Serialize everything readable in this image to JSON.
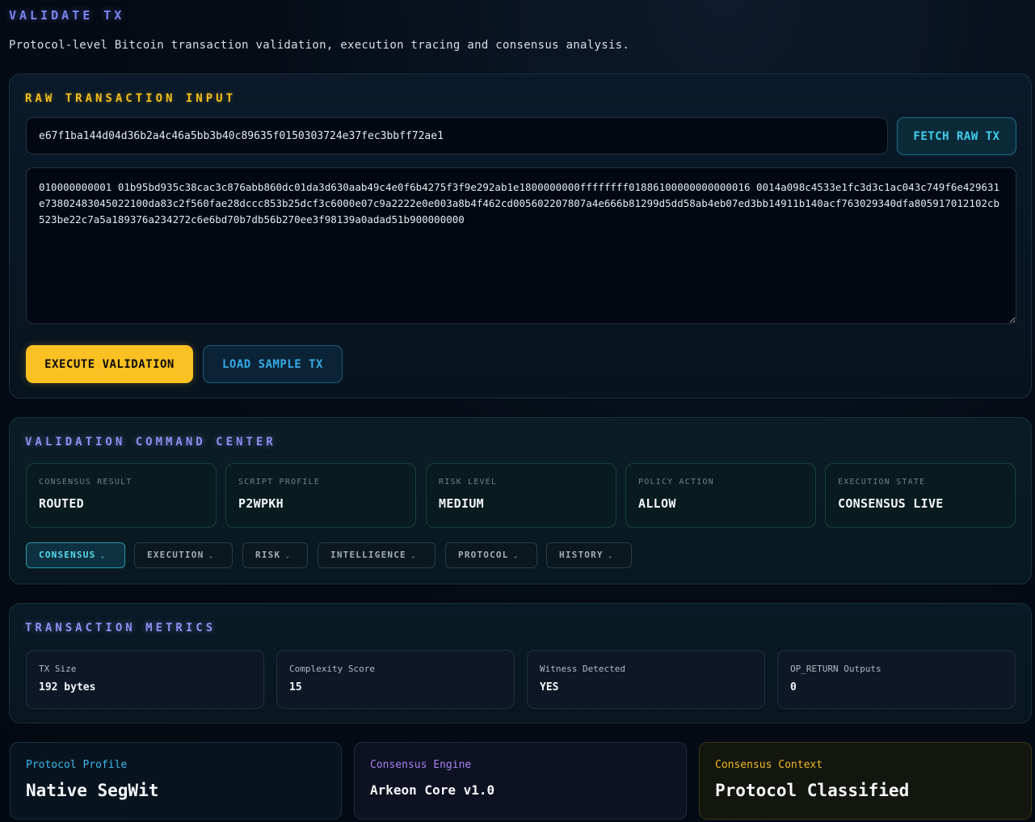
{
  "header": {
    "title": "VALIDATE TX",
    "subtitle": "Protocol-level Bitcoin transaction validation, execution tracing and consensus analysis."
  },
  "raw_input": {
    "heading": "RAW TRANSACTION INPUT",
    "txid_value": "e67f1ba144d04d36b2a4c46a5bb3b40c89635f0150303724e37fec3bbff72ae1",
    "fetch_label": "FETCH RAW TX",
    "raw_tx_value": "010000000001 01b95bd935c38cac3c876abb860dc01da3d630aab49c4e0f6b4275f3f9e292ab1e1800000000ffffffff01886100000000000016 0014a098c4533e1fc3d3c1ac043c749f6e429631e73802483045022100da83c2f560fae28dccc853b25dcf3c6000e07c9a2222e0e003a8b4f462cd005602207807a4e666b81299d5dd58ab4eb07ed3bb14911b140acf763029340dfa805917012102cb523be22c7a5a189376a234272c6e6bd70b7db56b270ee3f98139a0adad51b900000000",
    "execute_label": "EXECUTE VALIDATION",
    "sample_label": "LOAD SAMPLE TX"
  },
  "command_center": {
    "heading": "VALIDATION COMMAND CENTER",
    "stats": [
      {
        "label": "CONSENSUS RESULT",
        "value": "ROUTED"
      },
      {
        "label": "SCRIPT PROFILE",
        "value": "P2WPKH"
      },
      {
        "label": "RISK LEVEL",
        "value": "MEDIUM"
      },
      {
        "label": "POLICY ACTION",
        "value": "ALLOW"
      },
      {
        "label": "EXECUTION STATE",
        "value": "CONSENSUS LIVE"
      }
    ],
    "tabs": [
      {
        "label": "CONSENSUS"
      },
      {
        "label": "EXECUTION"
      },
      {
        "label": "RISK"
      },
      {
        "label": "INTELLIGENCE"
      },
      {
        "label": "PROTOCOL"
      },
      {
        "label": "HISTORY"
      }
    ],
    "chevron": "⌄"
  },
  "metrics": {
    "heading": "TRANSACTION METRICS",
    "items": [
      {
        "label": "TX Size",
        "value": "192 bytes"
      },
      {
        "label": "Complexity Score",
        "value": "15"
      },
      {
        "label": "Witness Detected",
        "value": "YES"
      },
      {
        "label": "OP_RETURN Outputs",
        "value": "0"
      }
    ]
  },
  "info_cards": {
    "protocol": {
      "label": "Protocol Profile",
      "value": "Native SegWit"
    },
    "engine": {
      "label": "Consensus Engine",
      "value": "Arkeon Core v1.0"
    },
    "context": {
      "label": "Consensus Context",
      "value": "Protocol Classified"
    }
  },
  "colors": {
    "accent_yellow": "#fbc021",
    "accent_cyan": "#40d0ef",
    "accent_violet": "#8c90f2",
    "background": "#030a13"
  }
}
